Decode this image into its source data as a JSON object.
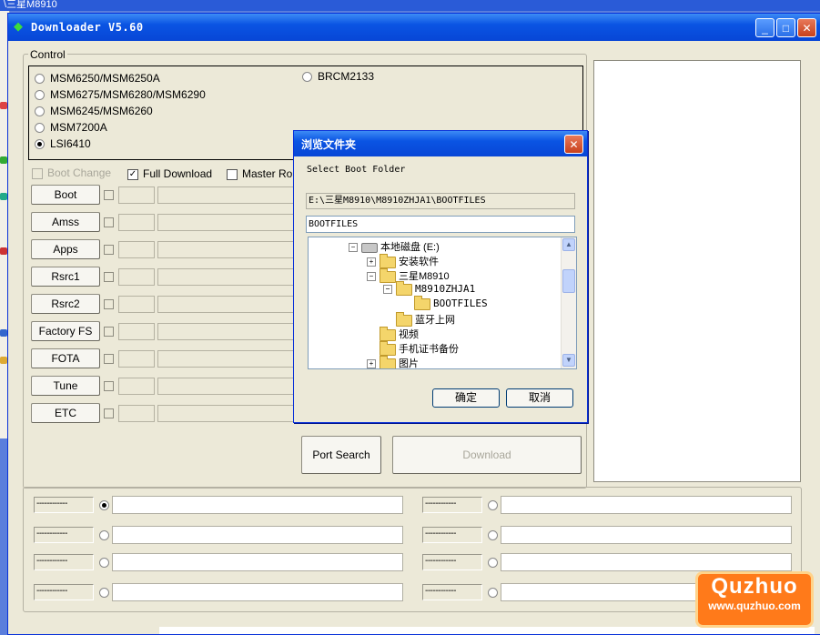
{
  "background_window": {
    "title": "\\三星M8910"
  },
  "window": {
    "title": "Downloader V5.60",
    "minimize_label": "_",
    "maximize_label": "□",
    "close_label": "✕"
  },
  "control": {
    "legend": "Control",
    "radios": [
      {
        "label": "MSM6250/MSM6250A",
        "selected": false
      },
      {
        "label": "MSM6275/MSM6280/MSM6290",
        "selected": false
      },
      {
        "label": "MSM6245/MSM6260",
        "selected": false
      },
      {
        "label": "MSM7200A",
        "selected": false
      },
      {
        "label": "LSI6410",
        "selected": true
      },
      {
        "label": "BRCM2133",
        "selected": false
      }
    ]
  },
  "options": {
    "boot_change": {
      "label": "Boot Change",
      "checked": false,
      "disabled": true
    },
    "full_download": {
      "label": "Full Download",
      "checked": true
    },
    "master_root": {
      "label": "Master Ro"
    }
  },
  "file_buttons": [
    "Boot",
    "Amss",
    "Apps",
    "Rsrc1",
    "Rsrc2",
    "Factory FS",
    "FOTA",
    "Tune",
    "ETC"
  ],
  "actions": {
    "port_search": "Port Search",
    "download": "Download"
  },
  "ports": [
    {
      "label": "------------",
      "selected": true
    },
    {
      "label": "------------",
      "selected": false
    },
    {
      "label": "------------",
      "selected": false
    },
    {
      "label": "------------",
      "selected": false
    },
    {
      "label": "------------",
      "selected": false
    },
    {
      "label": "------------",
      "selected": false
    },
    {
      "label": "------------",
      "selected": false
    },
    {
      "label": "------------",
      "selected": false
    }
  ],
  "dialog": {
    "title": "浏览文件夹",
    "close_label": "✕",
    "prompt": "Select Boot Folder",
    "path": "E:\\三星M8910\\M8910ZHJA1\\BOOTFILES",
    "folder_value": "BOOTFILES",
    "tree": [
      {
        "label": "本地磁盘 (E:)",
        "kind": "drive",
        "expander": "−"
      },
      {
        "label": "安装软件",
        "kind": "folder",
        "expander": "+"
      },
      {
        "label": "三星M8910",
        "kind": "folder",
        "expander": "−"
      },
      {
        "label": "M8910ZHJA1",
        "kind": "folder",
        "expander": "−"
      },
      {
        "label": "BOOTFILES",
        "kind": "folder",
        "expander": ""
      },
      {
        "label": "蓝牙上网",
        "kind": "folder",
        "expander": ""
      },
      {
        "label": "视频",
        "kind": "folder",
        "expander": ""
      },
      {
        "label": "手机证书备份",
        "kind": "folder",
        "expander": ""
      },
      {
        "label": "图片",
        "kind": "folder",
        "expander": "+"
      }
    ],
    "ok_label": "确定",
    "cancel_label": "取消",
    "scroll_up": "▲",
    "scroll_down": "▼"
  },
  "watermark": {
    "brand": "Quzhuo",
    "url": "www.quzhuo.com"
  },
  "colors": {
    "titlebar": "#0a54e3",
    "face": "#ece9d8",
    "watermark": "#ff7a1a"
  }
}
